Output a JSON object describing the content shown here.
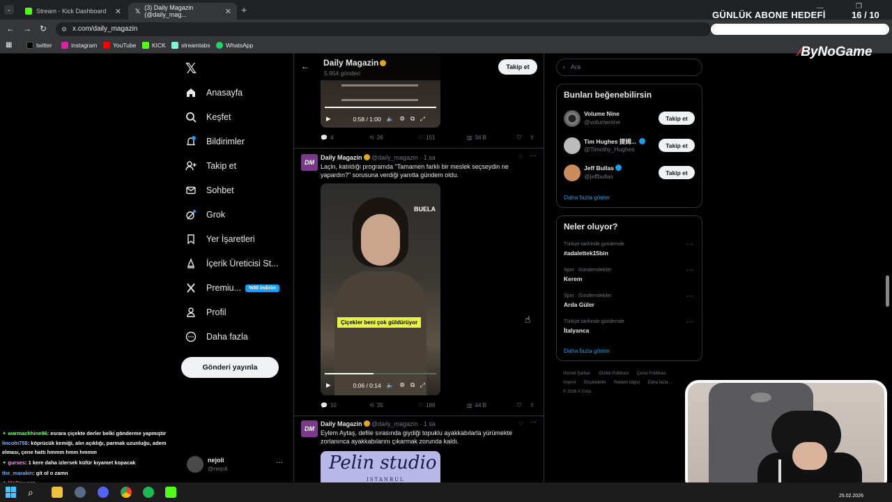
{
  "browser": {
    "tabs": [
      {
        "title": "Stream - Kick Dashboard"
      },
      {
        "title": "(3) Daily Magazin (@daily_mag..."
      }
    ],
    "url": "x.com/daily_magazin",
    "bookmarks": [
      "twitter",
      "instagram",
      "YouTube",
      "KICK",
      "streamlabs",
      "WhatsApp"
    ]
  },
  "overlay": {
    "goal_title": "GÜNLÜK ABONE HEDEFİ",
    "goal_count": "16  / 10",
    "goal_progress": 1.0,
    "brand": "ByNoGame"
  },
  "nav": {
    "items": [
      "Anasayfa",
      "Keşfet",
      "Bildirimler",
      "Takip et",
      "Sohbet",
      "Grok",
      "Yer İşaretleri",
      "İçerik Üreticisi St...",
      "Premiu...",
      "Profil",
      "Daha fazla"
    ],
    "premium_badge": "%50 indirim",
    "post_button": "Gönderi yayınla",
    "account_name": "nejoli",
    "account_handle": "@nejoli"
  },
  "profile_header": {
    "name": "Daily Magazin",
    "posts": "5.954 gönderi",
    "follow": "Takip et"
  },
  "tweets": [
    {
      "video_time": "0:58 / 1:00",
      "replies": "4",
      "reposts": "26",
      "likes": "151",
      "views": "34 B"
    },
    {
      "name": "Daily Magazin",
      "handle": "@daily_magazin",
      "time": "· 1 sa",
      "text": "Laçin, katıldığı programda \"Tamamen farklı bir meslek seçseydin ne yapardın?\" sorusuna verdiği yanıtla gündem oldu.",
      "caption": "Çiçekler beni çok güldürüyor",
      "watermark": "BUELA",
      "video_time": "0:06 / 0:14",
      "replies": "10",
      "reposts": "35",
      "likes": "189",
      "views": "44 B"
    },
    {
      "name": "Daily Magazin",
      "handle": "@daily_magazin",
      "time": "· 1 sa",
      "text": "Eylem Aytaş, defile sırasında giydiği topuklu ayakkabılarla yürümekte zorlanınca ayakkabılarını çıkarmak zorunda kaldı.",
      "image_text": "Pelin studio",
      "image_subtext": "ISTANBUL"
    }
  ],
  "sidebar": {
    "search_placeholder": "Ara",
    "suggest_title": "Bunları beğenebilirsin",
    "suggestions": [
      {
        "name": "Volume Nine",
        "handle": "@volumenine",
        "button": "Takip et"
      },
      {
        "name": "Tim Hughes 提姆...",
        "handle": "@Timothy_Hughes",
        "button": "Takip et"
      },
      {
        "name": "Jeff Bullas",
        "handle": "@jeffbullas",
        "button": "Takip et"
      }
    ],
    "show_more": "Daha fazla göster",
    "trends_title": "Neler oluyor?",
    "trends": [
      {
        "meta": "Türkiye tarihinde gündemde",
        "name": "#adalettek15bin"
      },
      {
        "meta": "Spor · Gündemdekiler",
        "name": "Kerem"
      },
      {
        "meta": "Spor · Gündemdekiler",
        "name": "Arda Güler"
      },
      {
        "meta": "Türkiye tarihinde gündemde",
        "name": "İtalyanca"
      }
    ],
    "footer": [
      "Hizmet Şartları",
      "Gizlilik Politikası",
      "Çerez Politikası",
      "Imprint",
      "Erişilebilirlik",
      "Reklam bilgisi",
      "Daha fazla ...",
      "© 2026 X Corp."
    ]
  },
  "chat": [
    {
      "user": "warmachhine96",
      "color": "#7dff7a",
      "msg": ": esrara çiçekte derler belki gönderme yapmıştır"
    },
    {
      "user": "lincoln755",
      "color": "#8fb8ff",
      "msg": ": köprücük kemiği, alın açıklığı, parmak uzunluğu, adem"
    },
    {
      "user": "",
      "color": "#ffffff",
      "msg": "elması, çene hattı hmmm hmm hmmm"
    },
    {
      "user": "gurses",
      "color": "#ff9cf0",
      "msg": ": 1 kere daha izlersek küfür kıyamet kopacak"
    },
    {
      "user": "the_marakin",
      "color": "#6ab6ff",
      "msg": ": git ol o zamn"
    },
    {
      "user": "MoDraven",
      "color": "#ff5a5a",
      "msg": ":"
    }
  ],
  "taskbar": {
    "date": "25.02.2026"
  }
}
